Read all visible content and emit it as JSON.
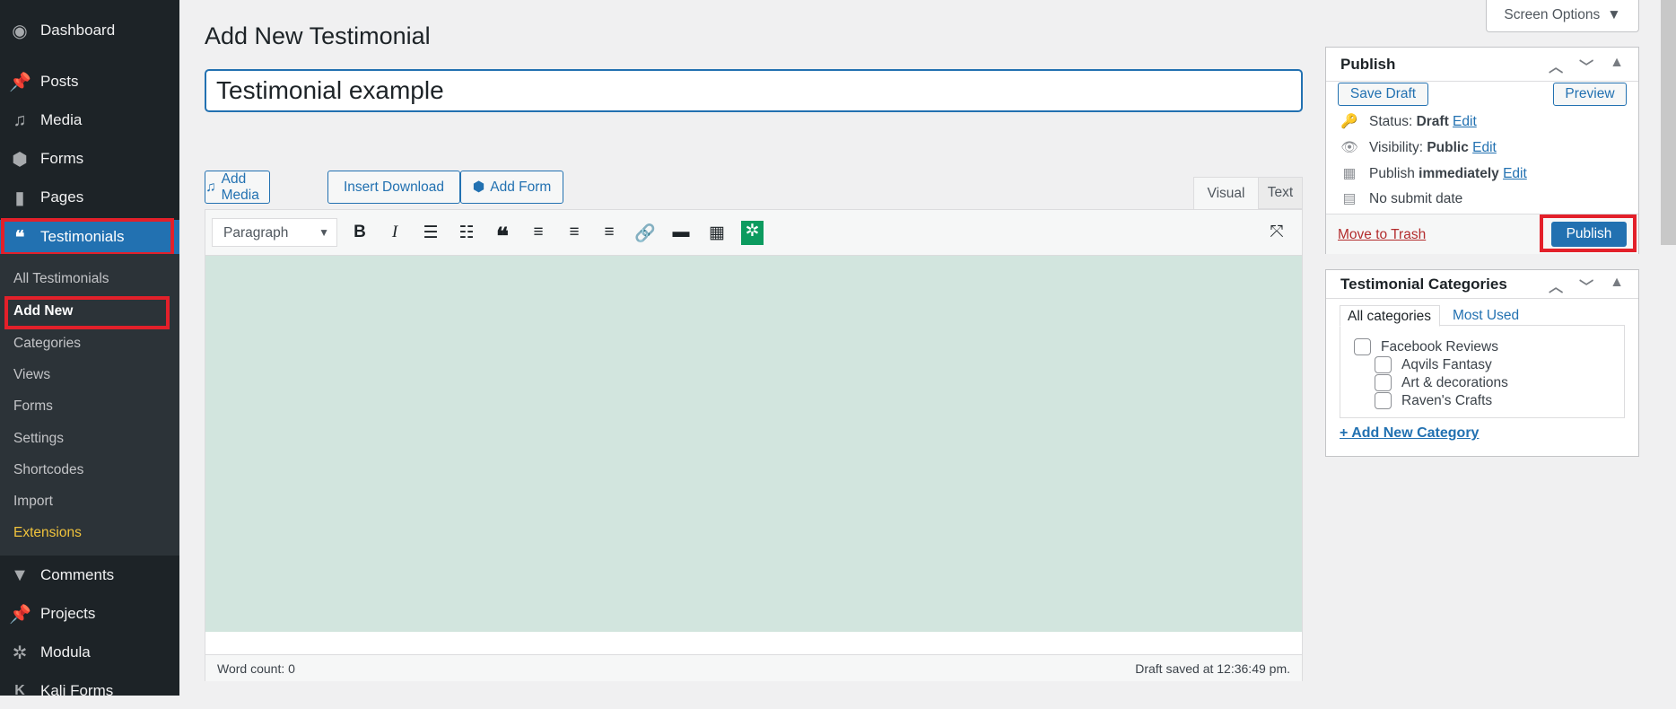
{
  "sidebar": {
    "top": [
      {
        "label": "Dashboard",
        "icon": "dashboard-icon"
      },
      {
        "label": "Posts",
        "icon": "pin-icon"
      },
      {
        "label": "Media",
        "icon": "media-icon"
      },
      {
        "label": "Forms",
        "icon": "forms-icon"
      },
      {
        "label": "Pages",
        "icon": "pages-icon"
      }
    ],
    "active": {
      "label": "Testimonials",
      "icon": "quote-icon"
    },
    "submenu": [
      "All Testimonials",
      "Add New",
      "Categories",
      "Views",
      "Forms",
      "Settings",
      "Shortcodes",
      "Import",
      "Extensions"
    ],
    "bottom": [
      {
        "label": "Comments",
        "icon": "comment-icon"
      },
      {
        "label": "Projects",
        "icon": "pin-icon"
      },
      {
        "label": "Modula",
        "icon": "modula-icon"
      },
      {
        "label": "Kali Forms",
        "icon": "kali-icon"
      }
    ]
  },
  "header": {
    "title": "Add New Testimonial",
    "screen_options": "Screen Options"
  },
  "title_input": {
    "value": "Testimonial example"
  },
  "editor": {
    "add_media": "Add Media",
    "insert_download": "Insert Download",
    "add_form": "Add Form",
    "tab_visual": "Visual",
    "tab_text": "Text",
    "format": "Paragraph",
    "word_count": "Word count: 0",
    "draft_saved": "Draft saved at 12:36:49 pm.",
    "content_bg": "#d2e5de"
  },
  "publish": {
    "title": "Publish",
    "save_draft": "Save Draft",
    "preview": "Preview",
    "status_label": "Status:",
    "status_value": "Draft",
    "visibility_label": "Visibility:",
    "visibility_value": "Public",
    "publish_label": "Publish",
    "publish_value": "immediately",
    "edit": "Edit",
    "no_submit": "No submit date",
    "trash": "Move to Trash",
    "publish_button": "Publish"
  },
  "categories": {
    "title": "Testimonial Categories",
    "tab_all": "All categories",
    "tab_most": "Most Used",
    "items": [
      "Facebook Reviews",
      "Aqvils Fantasy",
      "Art & decorations",
      "Raven's Crafts"
    ],
    "add_new": "+ Add New Category"
  },
  "colors": {
    "accent": "#2271b1",
    "highlight": "#e3202a",
    "sidebar": "#1d2327",
    "extensions": "#f0c33c"
  }
}
